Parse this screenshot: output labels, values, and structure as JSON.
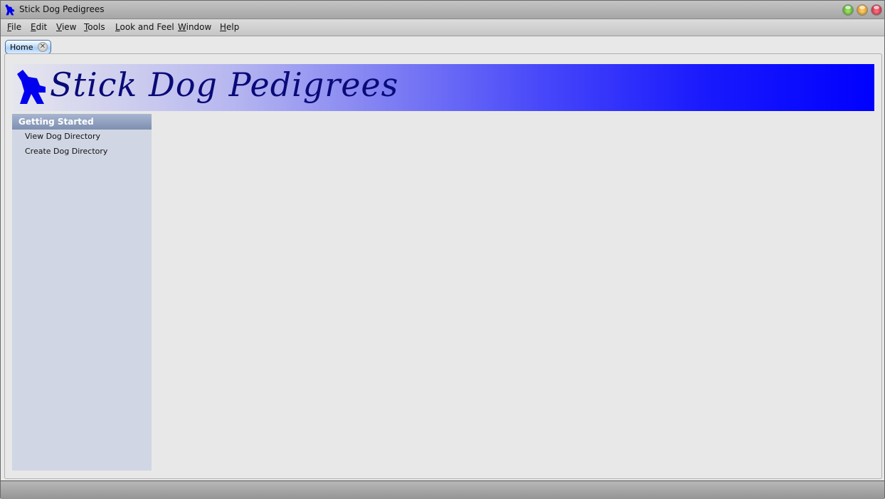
{
  "window": {
    "title": "Stick Dog Pedigrees",
    "controls": [
      "maximize",
      "minimize",
      "close"
    ]
  },
  "menubar": {
    "items": [
      {
        "label": "File",
        "mnemonic": "F",
        "rest": "ile"
      },
      {
        "label": "Edit",
        "mnemonic": "E",
        "rest": "dit"
      },
      {
        "label": "View",
        "mnemonic": "V",
        "rest": "iew"
      },
      {
        "label": "Tools",
        "mnemonic": "T",
        "rest": "ools"
      },
      {
        "label": "Look and Feel",
        "mnemonic": "L",
        "rest": "ook and Feel"
      },
      {
        "label": "Window",
        "mnemonic": "W",
        "rest": "indow"
      },
      {
        "label": "Help",
        "mnemonic": "H",
        "rest": "elp"
      }
    ]
  },
  "tabs": [
    {
      "label": "Home",
      "close_glyph": "✕",
      "active": true
    }
  ],
  "banner": {
    "title": "Stick Dog Pedigrees",
    "logo": "stick-dog-icon",
    "colors": {
      "start": "#e6e6ee",
      "end": "#0000ff",
      "text": "#0a0a78"
    }
  },
  "sidebar": {
    "header": "Getting Started",
    "links": [
      {
        "label": "View Dog Directory"
      },
      {
        "label": "Create Dog Directory"
      }
    ]
  }
}
